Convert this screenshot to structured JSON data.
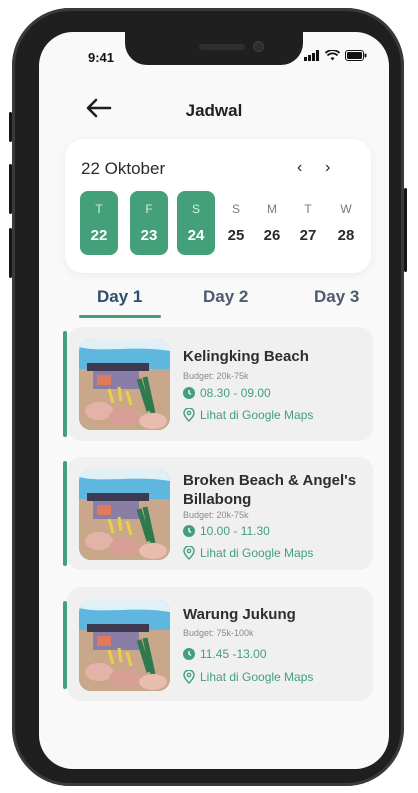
{
  "status": {
    "time": "9:41"
  },
  "header": {
    "title": "Jadwal"
  },
  "calendar": {
    "month": "22 Oktober",
    "prev": "‹",
    "next": "›",
    "days": [
      {
        "name": "T",
        "date": "22",
        "selected": true
      },
      {
        "name": "F",
        "date": "23",
        "selected": true
      },
      {
        "name": "S",
        "date": "24",
        "selected": true
      },
      {
        "name": "S",
        "date": "25",
        "selected": false
      },
      {
        "name": "M",
        "date": "26",
        "selected": false
      },
      {
        "name": "T",
        "date": "27",
        "selected": false
      },
      {
        "name": "W",
        "date": "28",
        "selected": false
      }
    ]
  },
  "tabs": [
    {
      "label": "Day 1",
      "active": true
    },
    {
      "label": "Day 2",
      "active": false
    },
    {
      "label": "Day 3",
      "active": false
    }
  ],
  "items": [
    {
      "title": "Kelingking Beach",
      "budget": "Budget: 20k-75k",
      "time": "08.30 - 09.00",
      "maps": "Lihat di Google Maps"
    },
    {
      "title": "Broken Beach & Angel's Billabong",
      "budget": "Budget: 20k-75k",
      "time": "10.00 - 11.30",
      "maps": "Lihat di Google Maps"
    },
    {
      "title": "Warung Jukung",
      "budget": "Budget: 75k-100k",
      "time": "11.45 -13.00",
      "maps": "Lihat di Google Maps"
    }
  ],
  "colors": {
    "accent": "#43a07a",
    "card": "#f0f0f0"
  },
  "icons": [
    "back-arrow-icon",
    "clock-icon",
    "location-pin-icon",
    "signal-icon",
    "wifi-icon",
    "battery-icon"
  ]
}
